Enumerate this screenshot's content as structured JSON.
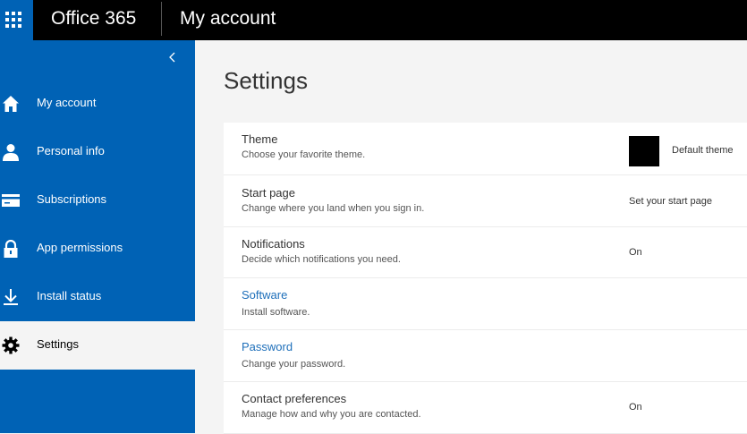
{
  "header": {
    "brand": "Office 365",
    "app_title": "My account",
    "app_launcher_icon": "waffle-icon"
  },
  "sidebar": {
    "collapse_icon": "chevron-left-icon",
    "items": [
      {
        "label": "My account",
        "icon": "home-icon"
      },
      {
        "label": "Personal info",
        "icon": "person-icon"
      },
      {
        "label": "Subscriptions",
        "icon": "card-icon"
      },
      {
        "label": "App permissions",
        "icon": "lock-icon"
      },
      {
        "label": "Install status",
        "icon": "download-icon"
      },
      {
        "label": "Settings",
        "icon": "gear-icon",
        "active": true
      }
    ]
  },
  "main": {
    "title": "Settings",
    "settings": [
      {
        "title": "Theme",
        "desc": "Choose your favorite theme.",
        "value": "Default theme"
      },
      {
        "title": "Start page",
        "desc": "Change where you land when you sign in.",
        "value": "Set your start page"
      },
      {
        "title": "Notifications",
        "desc": "Decide which notifications you need.",
        "value": "On"
      },
      {
        "title": "Software",
        "desc": "Install software.",
        "value": ""
      },
      {
        "title": "Password",
        "desc": "Change your password.",
        "value": ""
      },
      {
        "title": "Contact preferences",
        "desc": "Manage how and why you are contacted.",
        "value": "On"
      }
    ]
  },
  "colors": {
    "accent": "#0062b5",
    "link": "#1e6fba",
    "topbar": "#000000",
    "background": "#f4f4f4"
  }
}
